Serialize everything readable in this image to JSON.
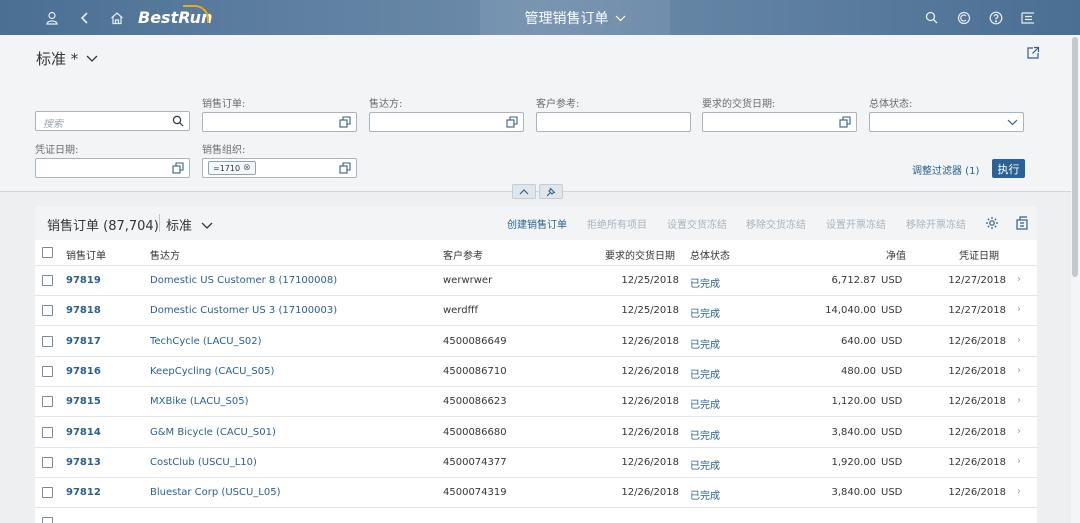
{
  "shell": {
    "brand": "BestRun",
    "title": "管理销售订单",
    "icons": [
      "user-icon",
      "back-icon",
      "home-icon",
      "search-icon",
      "copilot-icon",
      "help-icon",
      "notifications-icon"
    ]
  },
  "filterbar": {
    "variant": "标准 *",
    "search_placeholder": "搜索",
    "labels": {
      "sales_order": "销售订单:",
      "sold_to": "售达方:",
      "customer_ref": "客户参考:",
      "req_delivery_date": "要求的交货日期:",
      "overall_status": "总体状态:",
      "doc_date": "凭证日期:",
      "sales_org": "销售组织:"
    },
    "sales_org_token": "=1710",
    "adapt_filters": "调整过滤器 (1)",
    "go": "执行"
  },
  "table": {
    "title": "销售订单 (87,704)",
    "variant": "标准",
    "actions": {
      "create": "创建销售订单",
      "reject_all": "拒绝所有项目",
      "set_delivery_block": "设置交货冻结",
      "remove_delivery_block": "移除交货冻结",
      "set_billing_block": "设置开票冻结",
      "remove_billing_block": "移除开票冻结"
    },
    "columns": {
      "sales_order": "销售订单",
      "sold_to": "售达方",
      "customer_ref": "客户参考",
      "req_date": "要求的交货日期",
      "status": "总体状态",
      "net_value": "净值",
      "doc_date": "凭证日期"
    },
    "rows": [
      {
        "so": "97819",
        "sold_to": "Domestic US Customer 8 (17100008)",
        "ref": "werwrwer",
        "req_date": "12/25/2018",
        "status": "已完成",
        "net": "6,712.87",
        "currency": "USD",
        "doc_date": "12/27/2018"
      },
      {
        "so": "97818",
        "sold_to": "Domestic Customer US 3 (17100003)",
        "ref": "werdfff",
        "req_date": "12/25/2018",
        "status": "已完成",
        "net": "14,040.00",
        "currency": "USD",
        "doc_date": "12/27/2018"
      },
      {
        "so": "97817",
        "sold_to": "TechCycle (LACU_S02)",
        "ref": "4500086649",
        "req_date": "12/26/2018",
        "status": "已完成",
        "net": "640.00",
        "currency": "USD",
        "doc_date": "12/26/2018"
      },
      {
        "so": "97816",
        "sold_to": "KeepCycling (CACU_S05)",
        "ref": "4500086710",
        "req_date": "12/26/2018",
        "status": "已完成",
        "net": "480.00",
        "currency": "USD",
        "doc_date": "12/26/2018"
      },
      {
        "so": "97815",
        "sold_to": "MXBike (LACU_S05)",
        "ref": "4500086623",
        "req_date": "12/26/2018",
        "status": "已完成",
        "net": "1,120.00",
        "currency": "USD",
        "doc_date": "12/26/2018"
      },
      {
        "so": "97814",
        "sold_to": "G&M Bicycle (CACU_S01)",
        "ref": "4500086680",
        "req_date": "12/26/2018",
        "status": "已完成",
        "net": "3,840.00",
        "currency": "USD",
        "doc_date": "12/26/2018"
      },
      {
        "so": "97813",
        "sold_to": "CostClub (USCU_L10)",
        "ref": "4500074377",
        "req_date": "12/26/2018",
        "status": "已完成",
        "net": "1,920.00",
        "currency": "USD",
        "doc_date": "12/26/2018"
      },
      {
        "so": "97812",
        "sold_to": "Bluestar Corp (USCU_L05)",
        "ref": "4500074319",
        "req_date": "12/26/2018",
        "status": "已完成",
        "net": "3,840.00",
        "currency": "USD",
        "doc_date": "12/26/2018"
      }
    ]
  }
}
